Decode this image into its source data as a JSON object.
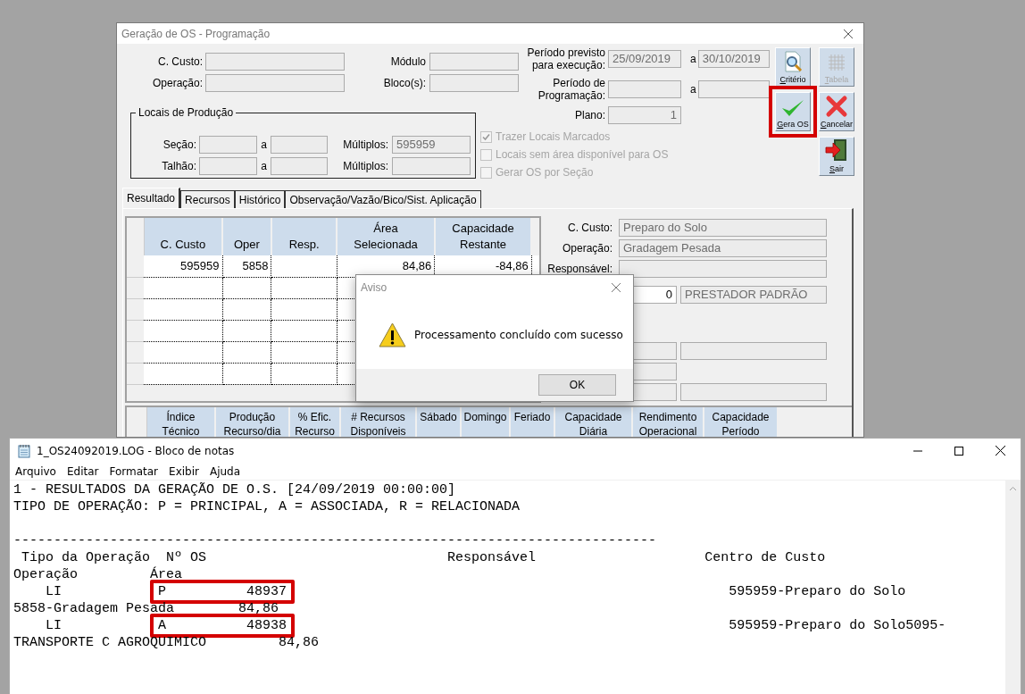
{
  "main_window": {
    "title": "Geração de OS - Programação",
    "left_fields": [
      {
        "label": "C. Custo:"
      },
      {
        "label": "Operação:"
      }
    ],
    "mid_fields": [
      {
        "label": "Módulo"
      },
      {
        "label": "Bloco(s):"
      }
    ],
    "period_fields": [
      {
        "label": "Período previsto para execução:",
        "from": "25/09/2019",
        "separator": "a",
        "to": "30/10/2019"
      },
      {
        "label": "Período de Programação:",
        "separator": "a"
      }
    ],
    "plan": {
      "label": "Plano:",
      "value": "1"
    },
    "production_group": {
      "title": "Locais de Produção",
      "rows": [
        {
          "label": "Seção:",
          "separator": "a",
          "multiple_label": "Múltiplos:",
          "multiple_value": "595959"
        },
        {
          "label": "Talhão:",
          "separator": "a",
          "multiple_label": "Múltiplos:"
        }
      ]
    },
    "options": [
      {
        "label": "Trazer Locais Marcados",
        "checked": true,
        "disabled": true
      },
      {
        "label": "Locais sem área disponível para OS",
        "checked": false,
        "disabled": true
      },
      {
        "label": "Gerar OS por Seção",
        "checked": false,
        "disabled": true
      }
    ],
    "button_columns": [
      [
        {
          "kind": "search",
          "label": "Critério",
          "disabled": false,
          "highlighted": false
        },
        {
          "kind": "check",
          "label": "Gera OS",
          "disabled": false,
          "highlighted": true
        }
      ],
      [
        {
          "kind": "grid",
          "label": "Tabela",
          "disabled": true,
          "highlighted": false
        },
        {
          "kind": "cross",
          "label": "Cancelar",
          "disabled": false,
          "highlighted": false
        },
        {
          "kind": "exit",
          "label": "Sair",
          "disabled": false,
          "highlighted": false
        }
      ]
    ],
    "tabs": [
      {
        "label": "Resultado",
        "selected": true
      },
      {
        "label": "Recursos",
        "selected": false
      },
      {
        "label": "Histórico",
        "selected": false
      },
      {
        "label": "Observação/Vazão/Bico/Sist. Aplicação",
        "selected": false
      }
    ],
    "result_table": {
      "columns": [
        "C. Custo",
        "Oper",
        "Resp.",
        "Área Selecionada",
        "Capacidade Restante"
      ],
      "rows": [
        {
          "cells": [
            "595959",
            "5858",
            null,
            "84,86",
            "-84,86"
          ]
        }
      ]
    },
    "details": [
      {
        "label": "C. Custo:",
        "value": "Preparo do Solo"
      },
      {
        "label": "Operação:",
        "value": "Gradagem Pesada"
      },
      {
        "label": "Responsável:"
      }
    ],
    "provider": {
      "code": "0",
      "name": "PRESTADOR PADRÃO"
    },
    "lower_table": {
      "columns": [
        "Índice Técnico",
        "Produção Recurso/dia",
        "% Efic. Recurso",
        "# Recursos Disponíveis",
        "Sábado",
        "Domingo",
        "Feriado",
        "Capacidade Diária",
        "Rendimento Operacional",
        "Capacidade Período"
      ]
    }
  },
  "dialog": {
    "title": "Aviso",
    "message": "Processamento concluído com sucesso",
    "button": "OK"
  },
  "notepad": {
    "title": "1_OS24092019.LOG - Bloco de notas",
    "menu": [
      "Arquivo",
      "Editar",
      "Formatar",
      "Exibir",
      "Ajuda"
    ],
    "lines": [
      {
        "kind": "text",
        "text": "1 - RESULTADOS DA GERAÇÃO DE O.S. [24/09/2019 00:00:00]"
      },
      {
        "kind": "text",
        "text": "TIPO DE OPERAÇÃO: P = PRINCIPAL, A = ASSOCIADA, R = RELACIONADA"
      },
      {
        "kind": "rule",
        "text": "--------------------------------------------------------------------------------"
      },
      {
        "kind": "text",
        "text": " Tipo da Operação  Nº OS                              Responsável                     Centro de Custo"
      },
      {
        "kind": "text",
        "text": "Operação         Área"
      },
      {
        "kind": "entry",
        "parts": [
          {
            "text": "    LI           ",
            "highlighted": false
          },
          {
            "text": "P          48937",
            "highlighted": true
          },
          {
            "text": "                                                      595959-Preparo do Solo",
            "highlighted": false
          }
        ]
      },
      {
        "kind": "text",
        "text": "5858-Gradagem Pesada        84,86"
      },
      {
        "kind": "entry",
        "parts": [
          {
            "text": "    LI           ",
            "highlighted": false
          },
          {
            "text": "A          48938",
            "highlighted": true
          },
          {
            "text": "                                                      595959-Preparo do Solo5095-",
            "highlighted": false
          }
        ]
      },
      {
        "kind": "text",
        "text": "TRANSPORTE C AGROQUIMICO         84,86"
      }
    ]
  }
}
